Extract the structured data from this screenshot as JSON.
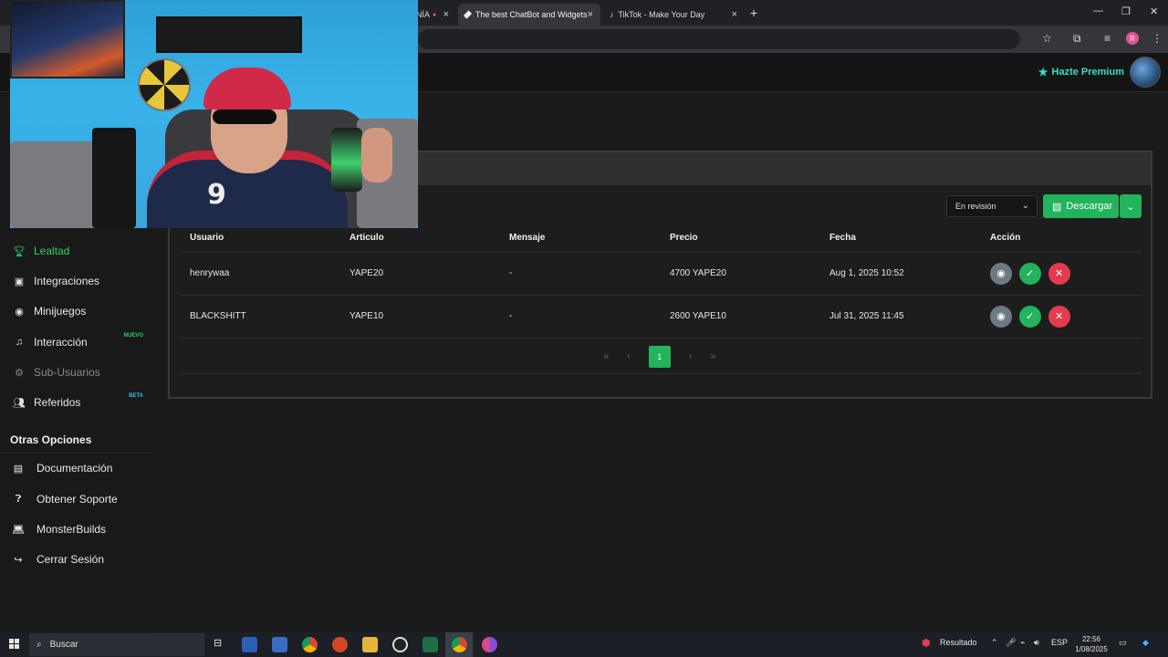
{
  "browser": {
    "tabs": [
      {
        "label": "NÍA",
        "active": false
      },
      {
        "label": "The best ChatBot and Widgets",
        "active": true
      },
      {
        "label": "TikTok - Make Your Day",
        "active": false
      }
    ],
    "new_tab_symbol": "+",
    "profile_initial": "R"
  },
  "header": {
    "premium_label": "Hazte Premium",
    "accent_color": "#35e0c8"
  },
  "sidebar": {
    "items": [
      {
        "label": "Lealtad",
        "icon": "trophy-icon",
        "state": "active",
        "badge": ""
      },
      {
        "label": "Integraciones",
        "icon": "window-icon",
        "state": "normal",
        "badge": ""
      },
      {
        "label": "Minijuegos",
        "icon": "gamepad-icon",
        "state": "normal",
        "badge": ""
      },
      {
        "label": "Interacción",
        "icon": "music-note-icon",
        "state": "normal",
        "badge": "NUEVO"
      },
      {
        "label": "Sub-Usuarios",
        "icon": "gear-icon",
        "state": "muted",
        "badge": ""
      },
      {
        "label": "Referidos",
        "icon": "users-icon",
        "state": "normal",
        "badge": "BETA"
      }
    ],
    "other_options_title": "Otras Opciones",
    "other_options": [
      {
        "label": "Documentación",
        "icon": "document-icon"
      },
      {
        "label": "Obtener Soporte",
        "icon": "question-icon"
      },
      {
        "label": "MonsterBuilds",
        "icon": "laptop-icon"
      },
      {
        "label": "Cerrar Sesión",
        "icon": "logout-icon"
      }
    ],
    "active_color": "#2fd26b"
  },
  "toolbar": {
    "status_filter": "En revisión",
    "download_label": "Descargar"
  },
  "table": {
    "headers": [
      "Usuario",
      "Articulo",
      "Mensaje",
      "Precio",
      "Fecha",
      "Acción"
    ],
    "rows": [
      [
        "henrywaa",
        "YAPE20",
        "-",
        "4700 YAPE20",
        "Aug 1, 2025 10:52"
      ],
      [
        "BLACKSHITT",
        "YAPE10",
        "-",
        "2600 YAPE10",
        "Jul 31, 2025 11:45"
      ]
    ]
  },
  "pagination": {
    "first": "«",
    "prev": "‹",
    "current": "1",
    "next": "›",
    "last": "»"
  },
  "taskbar": {
    "search_placeholder": "Buscar",
    "notification_label": "Resultado",
    "language": "ESP",
    "time": "22:56",
    "date": "1/08/2025"
  }
}
